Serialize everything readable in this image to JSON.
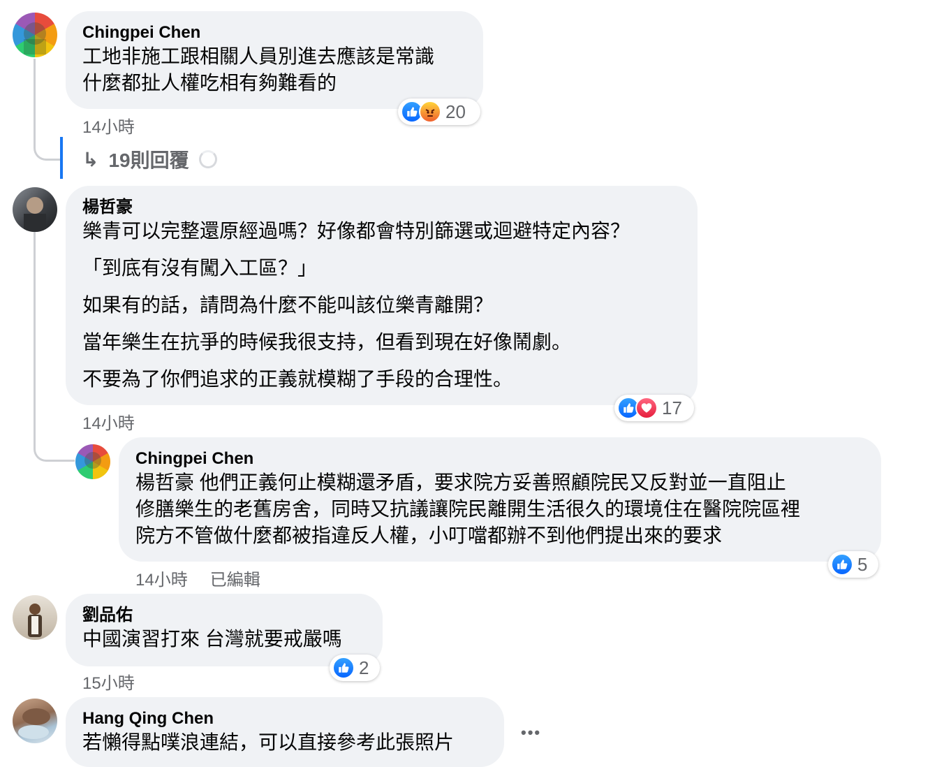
{
  "comments": [
    {
      "author": "Chingpei Chen",
      "lines": [
        "工地非施工跟相關人員別進去應該是常識",
        "什麼都扯人權吃相有夠難看的"
      ],
      "time": "14小時",
      "reactions": {
        "icons": [
          "like-icon",
          "angry-icon"
        ],
        "count": "20"
      },
      "replies": {
        "label": "19則回覆"
      }
    },
    {
      "author": "楊哲豪",
      "lines": [
        "樂青可以完整還原經過嗎？好像都會特別篩選或迴避特定內容？",
        "「到底有沒有闖入工區？」",
        "如果有的話，請問為什麼不能叫該位樂青離開？",
        "當年樂生在抗爭的時候我很支持，但看到現在好像鬧劇。",
        "不要為了你們追求的正義就模糊了手段的合理性。"
      ],
      "time": "14小時",
      "reactions": {
        "icons": [
          "like-icon",
          "love-icon"
        ],
        "count": "17"
      }
    },
    {
      "author": "Chingpei Chen",
      "lines": [
        "楊哲豪 他們正義何止模糊還矛盾，要求院方妥善照顧院民又反對並一直阻止",
        "修膳樂生的老舊房舍，同時又抗議讓院民離開生活很久的環境住在醫院院區裡",
        "院方不管做什麼都被指違反人權，小叮噹都辦不到他們提出來的要求"
      ],
      "time": "14小時",
      "edited": "已編輯",
      "reactions": {
        "icons": [
          "like-icon"
        ],
        "count": "5"
      }
    },
    {
      "author": "劉品佑",
      "lines": [
        "中國演習打來 台灣就要戒嚴嗎"
      ],
      "time": "15小時",
      "reactions": {
        "icons": [
          "like-icon"
        ],
        "count": "2"
      }
    },
    {
      "author": "Hang Qing Chen",
      "lines": [
        "若懶得點噗浪連結，可以直接參考此張照片"
      ],
      "more": "•••"
    }
  ],
  "colors": {
    "like": "#1877f2",
    "angry": "#f0612e",
    "love": "#e61e3d",
    "reply_bar": "#1877f2",
    "bubble": "#f0f2f5",
    "meta": "#65676b"
  }
}
